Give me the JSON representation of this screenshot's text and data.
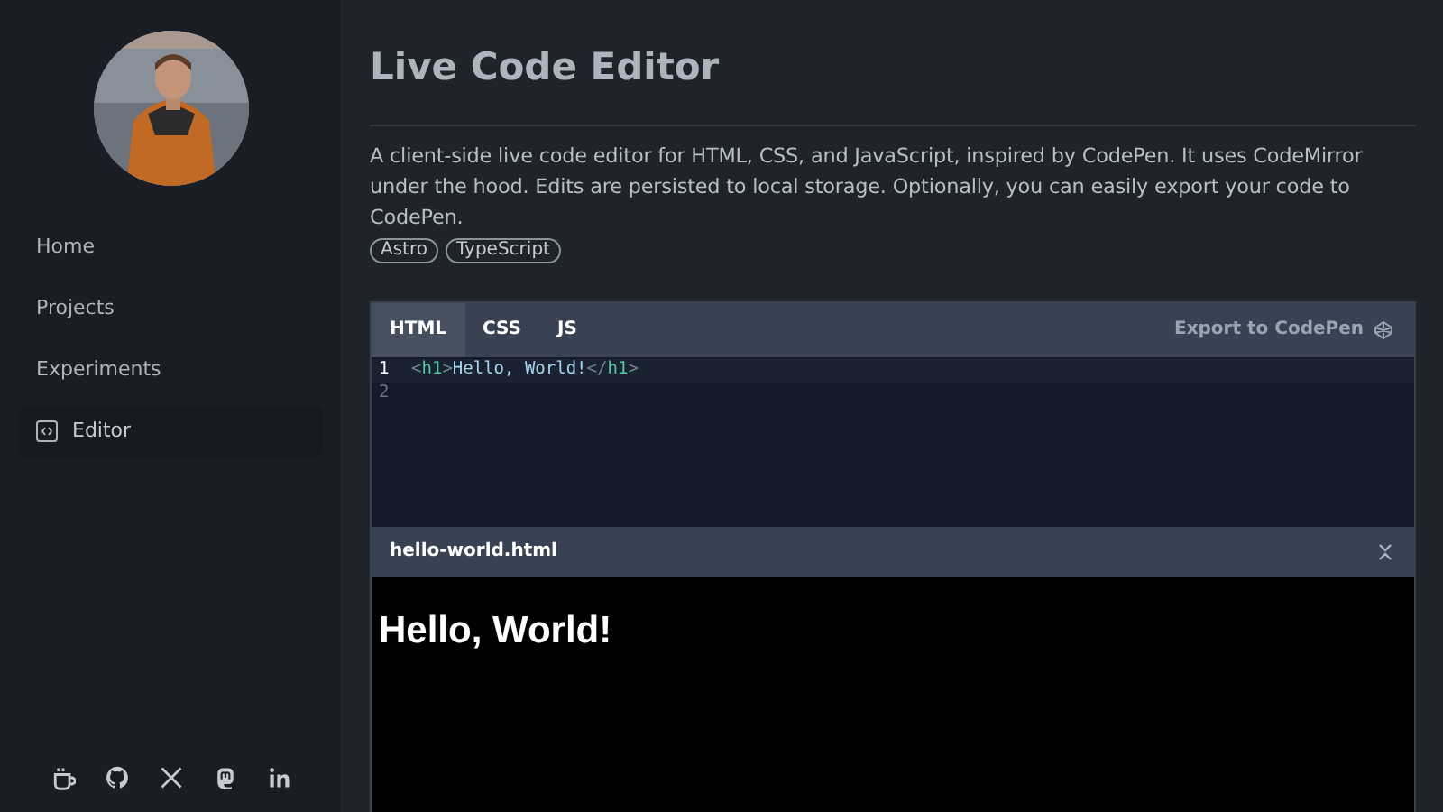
{
  "sidebar": {
    "nav": [
      {
        "kind": "text",
        "label": "Home",
        "selected": false
      },
      {
        "kind": "text",
        "label": "Projects",
        "selected": false
      },
      {
        "kind": "text",
        "label": "Experiments",
        "selected": false
      },
      {
        "kind": "code",
        "label": "Editor",
        "selected": true
      }
    ],
    "social": [
      {
        "kind": "coffee"
      },
      {
        "kind": "github"
      },
      {
        "kind": "x"
      },
      {
        "kind": "mastodon"
      },
      {
        "kind": "linkedin"
      }
    ]
  },
  "page": {
    "title": "Live Code Editor",
    "description": "A client-side live code editor for HTML, CSS, and JavaScript, inspired by CodePen. It uses CodeMirror under the hood. Edits are persisted to local storage. Optionally, you can easily export your code to CodePen.",
    "tags": [
      "Astro",
      "TypeScript"
    ]
  },
  "editor": {
    "tabs": [
      {
        "label": "HTML",
        "selected": true
      },
      {
        "label": "CSS",
        "selected": false
      },
      {
        "label": "JS",
        "selected": false
      }
    ],
    "export": "Export to CodePen",
    "lines": [
      {
        "number": "1",
        "active": true,
        "tokens": [
          {
            "kind": "punct",
            "text": "<"
          },
          {
            "kind": "tag",
            "text": "h1"
          },
          {
            "kind": "punct",
            "text": ">"
          },
          {
            "kind": "text",
            "text": "Hello, World!"
          },
          {
            "kind": "punct",
            "text": "</"
          },
          {
            "kind": "tag",
            "text": "h1"
          },
          {
            "kind": "punct",
            "text": ">"
          }
        ]
      },
      {
        "number": "2",
        "active": false
      }
    ]
  },
  "preview": {
    "filename": "hello-world.html",
    "heading": "Hello, World!"
  }
}
